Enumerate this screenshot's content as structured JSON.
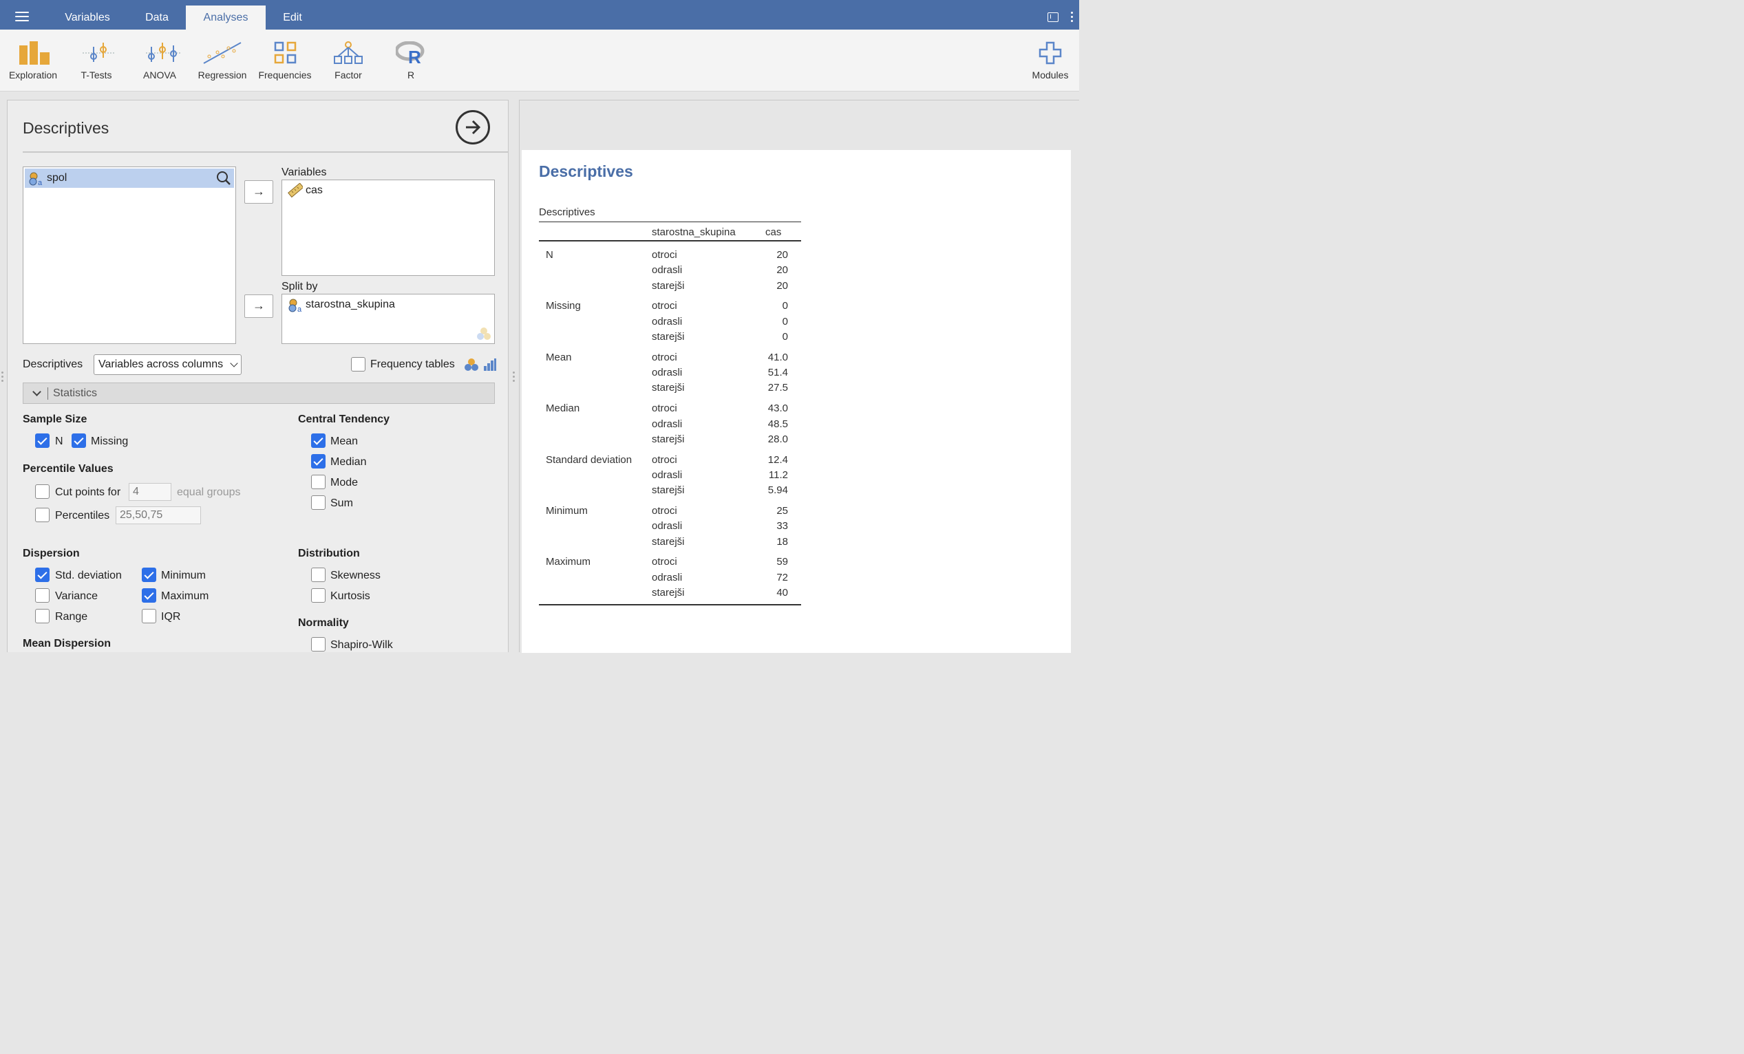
{
  "topbar": {
    "tabs": [
      {
        "label": "Variables",
        "active": false
      },
      {
        "label": "Data",
        "active": false
      },
      {
        "label": "Analyses",
        "active": true
      },
      {
        "label": "Edit",
        "active": false
      }
    ]
  },
  "ribbon": {
    "items": [
      {
        "label": "Exploration",
        "icon": "exploration-icon"
      },
      {
        "label": "T-Tests",
        "icon": "t-tests-icon"
      },
      {
        "label": "ANOVA",
        "icon": "anova-icon"
      },
      {
        "label": "Regression",
        "icon": "regression-icon"
      },
      {
        "label": "Frequencies",
        "icon": "frequencies-icon"
      },
      {
        "label": "Factor",
        "icon": "factor-icon"
      },
      {
        "label": "R",
        "icon": "r-icon"
      }
    ],
    "modules_label": "Modules"
  },
  "options": {
    "title": "Descriptives",
    "source_vars": [
      "spol"
    ],
    "variables_label": "Variables",
    "variables": [
      "cas"
    ],
    "split_label": "Split by",
    "split_vars": [
      "starostna_skupina"
    ],
    "descriptives_label": "Descriptives",
    "layout_select": "Variables across columns",
    "frequency_tables_label": "Frequency tables",
    "frequency_tables_checked": false,
    "statistics_label": "Statistics",
    "sample_size": {
      "heading": "Sample Size",
      "n_label": "N",
      "n": true,
      "missing_label": "Missing",
      "missing": true
    },
    "percentile": {
      "heading": "Percentile Values",
      "cut_label": "Cut points for",
      "cut_value": "4",
      "cut_suffix": "equal groups",
      "cut": false,
      "perc_label": "Percentiles",
      "perc_value": "25,50,75",
      "perc": false
    },
    "central": {
      "heading": "Central Tendency",
      "mean_label": "Mean",
      "mean": true,
      "median_label": "Median",
      "median": true,
      "mode_label": "Mode",
      "mode": false,
      "sum_label": "Sum",
      "sum": false
    },
    "dispersion": {
      "heading": "Dispersion",
      "sd_label": "Std. deviation",
      "sd": true,
      "min_label": "Minimum",
      "min": true,
      "var_label": "Variance",
      "var": false,
      "max_label": "Maximum",
      "max": true,
      "range_label": "Range",
      "range": false,
      "iqr_label": "IQR",
      "iqr": false
    },
    "distribution": {
      "heading": "Distribution",
      "skew_label": "Skewness",
      "skew": false,
      "kurt_label": "Kurtosis",
      "kurt": false
    },
    "normality": {
      "heading": "Normality",
      "sw_label": "Shapiro-Wilk",
      "sw": false
    },
    "mean_dispersion": {
      "heading": "Mean Dispersion"
    }
  },
  "results": {
    "title": "Descriptives",
    "table_caption": "Descriptives",
    "col_group": "starostna_skupina",
    "col_var": "cas",
    "rows": [
      {
        "stat": "N",
        "groups": [
          "otroci",
          "odrasli",
          "starejši"
        ],
        "values": [
          "20",
          "20",
          "20"
        ]
      },
      {
        "stat": "Missing",
        "groups": [
          "otroci",
          "odrasli",
          "starejši"
        ],
        "values": [
          "0",
          "0",
          "0"
        ]
      },
      {
        "stat": "Mean",
        "groups": [
          "otroci",
          "odrasli",
          "starejši"
        ],
        "values": [
          "41.0",
          "51.4",
          "27.5"
        ]
      },
      {
        "stat": "Median",
        "groups": [
          "otroci",
          "odrasli",
          "starejši"
        ],
        "values": [
          "43.0",
          "48.5",
          "28.0"
        ]
      },
      {
        "stat": "Standard deviation",
        "groups": [
          "otroci",
          "odrasli",
          "starejši"
        ],
        "values": [
          "12.4",
          "11.2",
          "5.94"
        ]
      },
      {
        "stat": "Minimum",
        "groups": [
          "otroci",
          "odrasli",
          "starejši"
        ],
        "values": [
          "25",
          "33",
          "18"
        ]
      },
      {
        "stat": "Maximum",
        "groups": [
          "otroci",
          "odrasli",
          "starejši"
        ],
        "values": [
          "59",
          "72",
          "40"
        ]
      }
    ]
  },
  "colors": {
    "topbar": "#4a6ea7",
    "accent": "#2d6fe8",
    "ribbon_orange": "#e6a73a",
    "ribbon_blue": "#5b86c9"
  }
}
